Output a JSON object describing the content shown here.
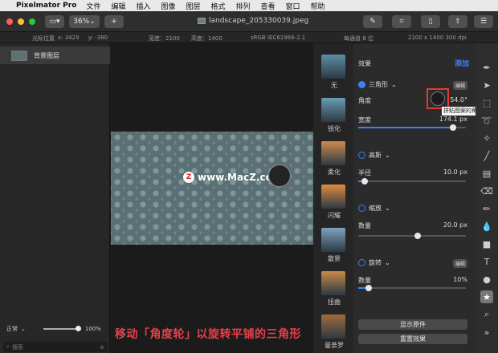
{
  "menubar": {
    "app_name": "Pixelmator Pro",
    "items": [
      "文件",
      "编辑",
      "插入",
      "图像",
      "图层",
      "格式",
      "排列",
      "查看",
      "窗口",
      "帮助"
    ]
  },
  "toolbar": {
    "zoom": "36%",
    "add_label": "+",
    "doc_title": "landscape_205330039.jpeg"
  },
  "infobar": {
    "cursor_label": "光标位置",
    "cursor_x": "x: 3429",
    "cursor_y": "y: -380",
    "width": "宽度：2100",
    "height": "高度：1400",
    "colorspace": "sRGB IEC61966-2.1",
    "bit_depth": "每通道 8 位",
    "dimensions": "2100 x 1400 300 dpi"
  },
  "layers": {
    "layer_name": "背景图层",
    "blend_mode": "正常",
    "opacity": "100%",
    "search_placeholder": "搜索"
  },
  "canvas": {
    "watermark": "www.MacZ.com"
  },
  "presets": [
    {
      "label": "无",
      "color": "#5b8fa6"
    },
    {
      "label": "锐化",
      "color": "#6a9bb1"
    },
    {
      "label": "柔化",
      "color": "#d08a4c"
    },
    {
      "label": "闪耀",
      "color": "#e08a3c"
    },
    {
      "label": "散景",
      "color": "#7ea2bd"
    },
    {
      "label": "扭曲",
      "color": "#c88a48"
    },
    {
      "label": "曼荼罗",
      "color": "#a06a3a"
    }
  ],
  "effects": {
    "header": "效果",
    "add_label": "添加",
    "triangle": {
      "name": "三角形",
      "edit": "编辑",
      "angle_label": "角度",
      "angle_value": "54.0°",
      "width_label": "宽度",
      "width_value": "174.1 px",
      "width_fraction": 0.88
    },
    "highpass": {
      "name": "高斯",
      "radius_label": "半径",
      "radius_value": "10.0 px",
      "radius_fraction": 0.06
    },
    "scale": {
      "name": "缩放",
      "amount_label": "数量",
      "amount_value": "20.0 px",
      "amount_fraction": 0.55
    },
    "rotate": {
      "name": "旋转",
      "edit": "编辑",
      "amount_label": "数量",
      "amount_value": "10%",
      "amount_fraction": 0.1
    },
    "show_original": "显示原件",
    "reset": "重置效果"
  },
  "tooltip": "拼贴图案的角度（以度为单位）",
  "caption": "移动「角度轮」以旋转平铺的三角形",
  "colors": {
    "accent": "#3b82f6",
    "highlight_box": "#e23b32",
    "caption": "#e8404a"
  }
}
